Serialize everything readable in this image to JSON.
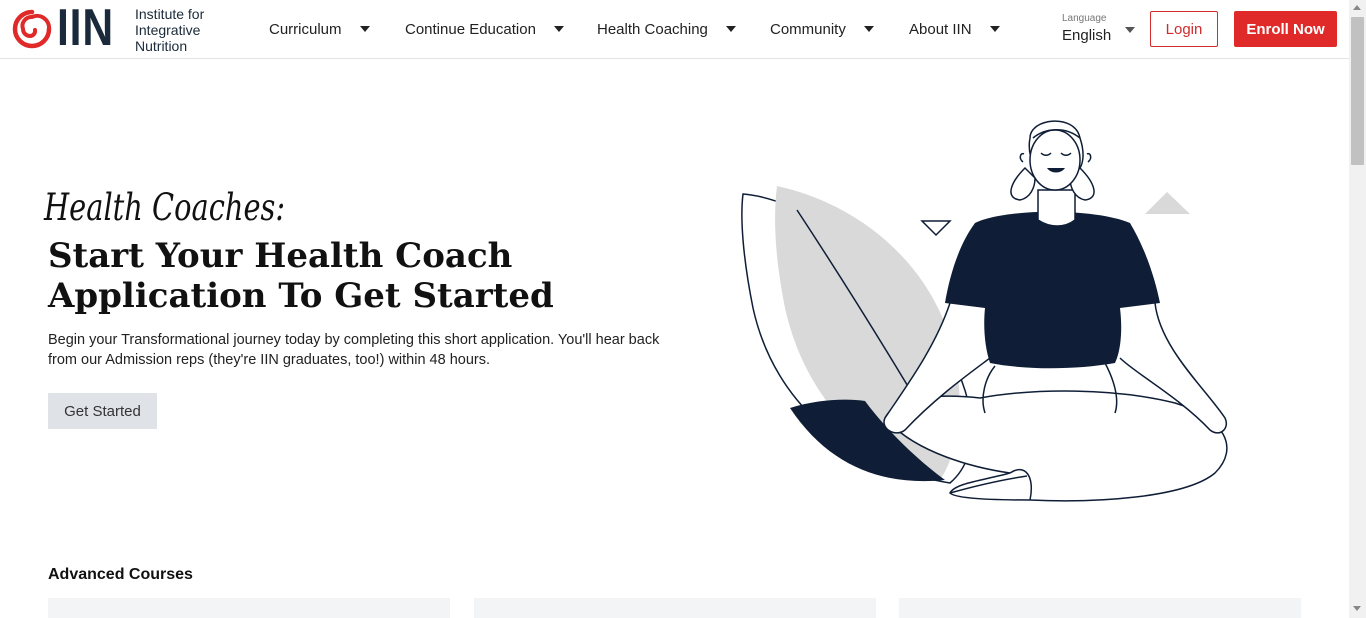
{
  "header": {
    "logo": {
      "wordmark": "IIN",
      "text": "Institute for\nIntegrative\nNutrition"
    },
    "nav": [
      {
        "label": "Curriculum"
      },
      {
        "label": "Continue Education"
      },
      {
        "label": "Health Coaching"
      },
      {
        "label": "Community"
      },
      {
        "label": "About IIN"
      }
    ],
    "language": {
      "label": "Language",
      "value": "English"
    },
    "login_label": "Login",
    "enroll_label": "Enroll Now"
  },
  "hero": {
    "script_heading": "Health Coaches:",
    "title": "Start Your Health Coach Application To Get Started",
    "description": "Begin your Transformational journey today by completing this short application. You'll hear back from our Admission reps (they're IIN graduates, too!) within 48 hours.",
    "cta_label": "Get Started",
    "illustration_icon": "meditating-woman-illustration"
  },
  "advanced_courses": {
    "title": "Advanced Courses",
    "cards": [
      {},
      {},
      {}
    ]
  },
  "colors": {
    "brand_red": "#e02a2a",
    "navy": "#0f1e36",
    "leaf_gray": "#d9d9d9",
    "button_gray": "#dfe3e8"
  }
}
